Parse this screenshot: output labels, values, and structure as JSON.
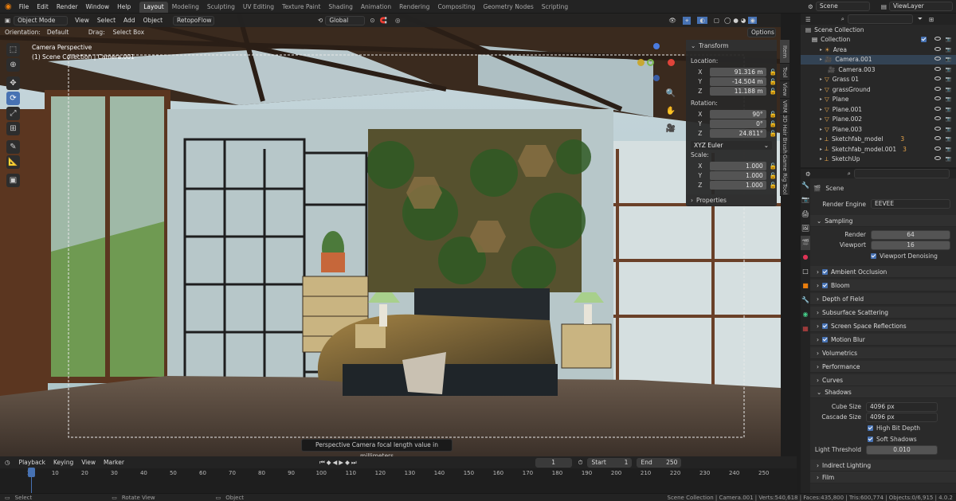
{
  "topbar": {
    "menus": [
      "File",
      "Edit",
      "Render",
      "Window",
      "Help"
    ],
    "workspaces": [
      "Layout",
      "Modeling",
      "Sculpting",
      "UV Editing",
      "Texture Paint",
      "Shading",
      "Animation",
      "Rendering",
      "Compositing",
      "Geometry Nodes",
      "Scripting"
    ],
    "scene": "Scene",
    "viewlayer": "ViewLayer"
  },
  "viewport_header": {
    "mode": "Object Mode",
    "menus": [
      "View",
      "Select",
      "Add",
      "Object"
    ],
    "addon": "RetopoFlow",
    "transform_orientation": "Global"
  },
  "viewport_header2": {
    "orientation_label": "Orientation:",
    "orientation_value": "Default",
    "drag_label": "Drag:",
    "drag_value": "Select Box",
    "options": "Options"
  },
  "overlay_text": {
    "line1": "Camera Perspective",
    "line2": "(1) Scene Collection | Camera.001"
  },
  "tooltip": "Perspective Camera focal length value in millimeters",
  "npanel": {
    "title": "Transform",
    "location_label": "Location:",
    "location": [
      {
        "axis": "X",
        "value": "91.316 m"
      },
      {
        "axis": "Y",
        "value": "-14.504 m"
      },
      {
        "axis": "Z",
        "value": "11.188 m"
      }
    ],
    "rotation_label": "Rotation:",
    "rotation": [
      {
        "axis": "X",
        "value": "90°"
      },
      {
        "axis": "Y",
        "value": "0°"
      },
      {
        "axis": "Z",
        "value": "24.811°"
      }
    ],
    "rotation_mode": "XYZ Euler",
    "scale_label": "Scale:",
    "scale": [
      {
        "axis": "X",
        "value": "1.000"
      },
      {
        "axis": "Y",
        "value": "1.000"
      },
      {
        "axis": "Z",
        "value": "1.000"
      }
    ],
    "properties": "Properties"
  },
  "sidetabs": [
    "Item",
    "Tool",
    "View",
    "VRM",
    "3D Hair Brush",
    "Game Rig Tool"
  ],
  "outliner": {
    "root": "Scene Collection",
    "items": [
      "Collection",
      "Area",
      "Camera.001",
      "Camera.003",
      "Grass 01",
      "grassGround",
      "Plane",
      "Plane.001",
      "Plane.002",
      "Plane.003",
      "Sketchfab_model",
      "Sketchfab_model.001",
      "SketchUp"
    ],
    "badges": {
      "sketchfab": "3",
      "sketchfab001": "3"
    }
  },
  "properties": {
    "breadcrumb": "Scene",
    "render_engine_label": "Render Engine",
    "render_engine": "EEVEE",
    "sampling": "Sampling",
    "render_label": "Render",
    "render_value": "64",
    "viewport_label": "Viewport",
    "viewport_value": "16",
    "viewport_denoising": "Viewport Denoising",
    "panels": [
      "Ambient Occlusion",
      "Bloom",
      "Depth of Field",
      "Subsurface Scattering",
      "Screen Space Reflections",
      "Motion Blur",
      "Volumetrics",
      "Performance",
      "Curves"
    ],
    "shadows": "Shadows",
    "cube_size_label": "Cube Size",
    "cube_size": "4096 px",
    "cascade_size_label": "Cascade Size",
    "cascade_size": "4096 px",
    "high_bit_depth": "High Bit Depth",
    "soft_shadows": "Soft Shadows",
    "light_threshold_label": "Light Threshold",
    "light_threshold": "0.010",
    "indirect_lighting": "Indirect Lighting",
    "film": "Film"
  },
  "timeline": {
    "menus": [
      "Playback",
      "Keying",
      "View",
      "Marker"
    ],
    "current_frame": "1",
    "start_label": "Start",
    "start": "1",
    "end_label": "End",
    "end": "250",
    "ticks": [
      "1",
      "10",
      "20",
      "30",
      "40",
      "50",
      "60",
      "70",
      "80",
      "90",
      "100",
      "110",
      "120",
      "130",
      "140",
      "150",
      "160",
      "170",
      "180",
      "190",
      "200",
      "210",
      "220",
      "230",
      "240",
      "250"
    ]
  },
  "status": {
    "select": "Select",
    "rotate": "Rotate View",
    "object": "Object",
    "info": "Scene Collection | Camera.001 | Verts:540,618 | Faces:435,800 | Tris:600,774 | Objects:0/6,915 | 4.0.2"
  }
}
